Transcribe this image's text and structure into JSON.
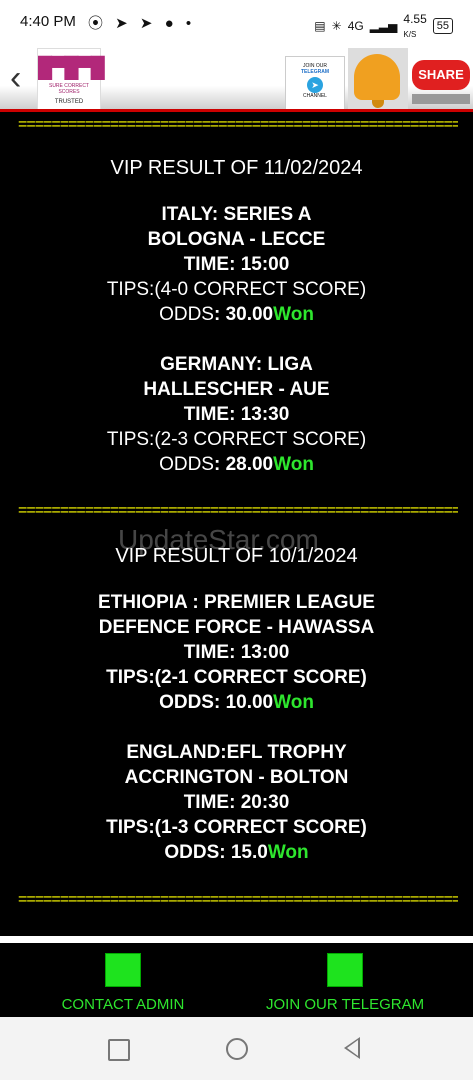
{
  "status": {
    "time": "4:40 PM",
    "notif_icons": "⦿ ➤ ➤ ● •",
    "right_text": "4G",
    "speed": "4.55",
    "speed_unit": "K/S",
    "battery": "55"
  },
  "header": {
    "logo_line1": "SURE CORRECT SCORES",
    "logo_line2": "TRUSTED",
    "tg_line1": "JOIN OUR",
    "tg_line2": "TELEGRAM",
    "tg_line3": "CHANNEL",
    "share_label": "SHARE"
  },
  "separator": "=====================================================",
  "results": [
    {
      "title": "VIP RESULT OF 11/02/2024",
      "matches": [
        {
          "league": "ITALY: SERIES A",
          "teams": "BOLOGNA - LECCE",
          "time": "TIME: 15:00",
          "tips": "TIPS:(4-0 CORRECT SCORE)",
          "odds_label": "ODDS",
          "odds_value": ": 30.00",
          "status": "Won"
        },
        {
          "league": "GERMANY: LIGA",
          "teams": "HALLESCHER - AUE",
          "time": "TIME: 13:30",
          "tips": "TIPS:(2-3 CORRECT SCORE)",
          "odds_label": "ODDS",
          "odds_value": ": 28.00",
          "status": "Won"
        }
      ]
    },
    {
      "title": "VIP RESULT OF 10/1/2024",
      "matches": [
        {
          "league": "ETHIOPIA : PREMIER LEAGUE",
          "teams": "DEFENCE FORCE - HAWASSA",
          "time": "TIME: 13:00",
          "tips": "TIPS:(2-1 CORRECT SCORE)",
          "odds_label": "ODDS",
          "odds_value": ": 10.00",
          "status": "Won"
        },
        {
          "league": "ENGLAND:EFL TROPHY",
          "teams": "ACCRINGTON - BOLTON",
          "time": "TIME: 20:30",
          "tips": "TIPS:(1-3 CORRECT SCORE)",
          "odds_label": "ODDS",
          "odds_value": ": 15.0",
          "status": "Won"
        }
      ]
    }
  ],
  "watermark": "UpdateStar.com",
  "bottom": {
    "contact": "CONTACT ADMIN",
    "telegram": "JOIN OUR TELEGRAM"
  },
  "colors": {
    "accent_green": "#2ee62e",
    "separator_yellow": "#ffff00",
    "header_red": "#cc0000"
  }
}
